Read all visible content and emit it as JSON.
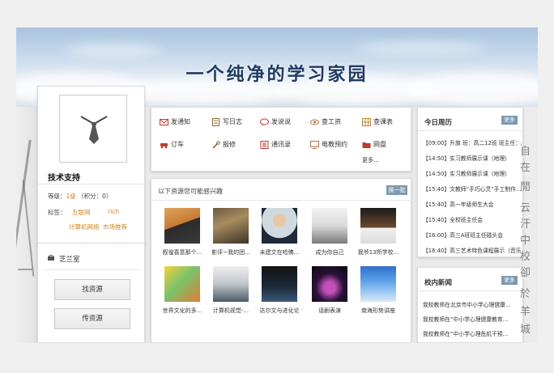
{
  "banner": {
    "title": "一个纯净的学习家园"
  },
  "profile": {
    "name": "技术支持",
    "level_label": "等级：",
    "level_value": "1级",
    "points": "（积分：0）",
    "tags_label": "标签：",
    "tags": [
      "互联网",
      "rich",
      "计算机网络",
      "市场推荐"
    ]
  },
  "zhilan": {
    "title": "芝兰室",
    "buttons": [
      "找资源",
      "传资源"
    ]
  },
  "quick_menu": {
    "items": [
      {
        "label": "发通知",
        "icon": "mail-icon",
        "color": "#c0392b"
      },
      {
        "label": "写日志",
        "icon": "note-icon",
        "color": "#8a6d3b"
      },
      {
        "label": "发说说",
        "icon": "chat-icon",
        "color": "#c0392b"
      },
      {
        "label": "查工资",
        "icon": "eye-icon",
        "color": "#b9704a"
      },
      {
        "label": "查课表",
        "icon": "grid-icon",
        "color": "#c08a3e"
      },
      {
        "label": "订车",
        "icon": "car-icon",
        "color": "#c0392b"
      },
      {
        "label": "报修",
        "icon": "wrench-icon",
        "color": "#8a6d3b"
      },
      {
        "label": "通讯录",
        "icon": "contacts-icon",
        "color": "#c0392b"
      },
      {
        "label": "电教预约",
        "icon": "monitor-icon",
        "color": "#b9704a"
      },
      {
        "label": "网盘",
        "icon": "folder-icon",
        "color": "#c0392b"
      }
    ],
    "more": "更多..."
  },
  "resources": {
    "header": "以下资源您可能感兴趣",
    "swap": "换一批",
    "items": [
      {
        "caption": "叙徨喜意那个..."
      },
      {
        "caption": "影评~我的团..."
      },
      {
        "caption": "未建文在哈佛..."
      },
      {
        "caption": "成为你自己"
      },
      {
        "caption": "我爷13所学校..."
      },
      {
        "caption": "世界文化的多..."
      },
      {
        "caption": "计算机视觉-..."
      },
      {
        "caption": "达尔文与进化论"
      },
      {
        "caption": "话剧表演"
      },
      {
        "caption": "南海形势讲座"
      }
    ]
  },
  "schedule": {
    "title": "今日周历",
    "more": "更多",
    "items": [
      "【09:00】升旗 班：高二12班 班主任：周...",
      "【14:50】实习教师展示课（地理）",
      "【14:50】实习教师展示课（地理）",
      "【15:40】文教师“手巧心灵”手工制作...",
      "【15:40】高一年级师生大会",
      "【15:40】全校班主任会",
      "【16:00】高三A班班主任碰头会",
      "【16:40】高三艺术特色课程展示（音乐）"
    ]
  },
  "news": {
    "title": "校内新闻",
    "more": "更多",
    "items": [
      "我校教师在北京市中小学心理健康...",
      "我校教师在“中小学心理健康教育...",
      "我校教师在“中小学心理危机干预..."
    ]
  },
  "side_text": [
    "自",
    "在",
    "閒",
    "云",
    "汗",
    "中",
    "校",
    "卻",
    "於",
    "羊",
    "城"
  ]
}
